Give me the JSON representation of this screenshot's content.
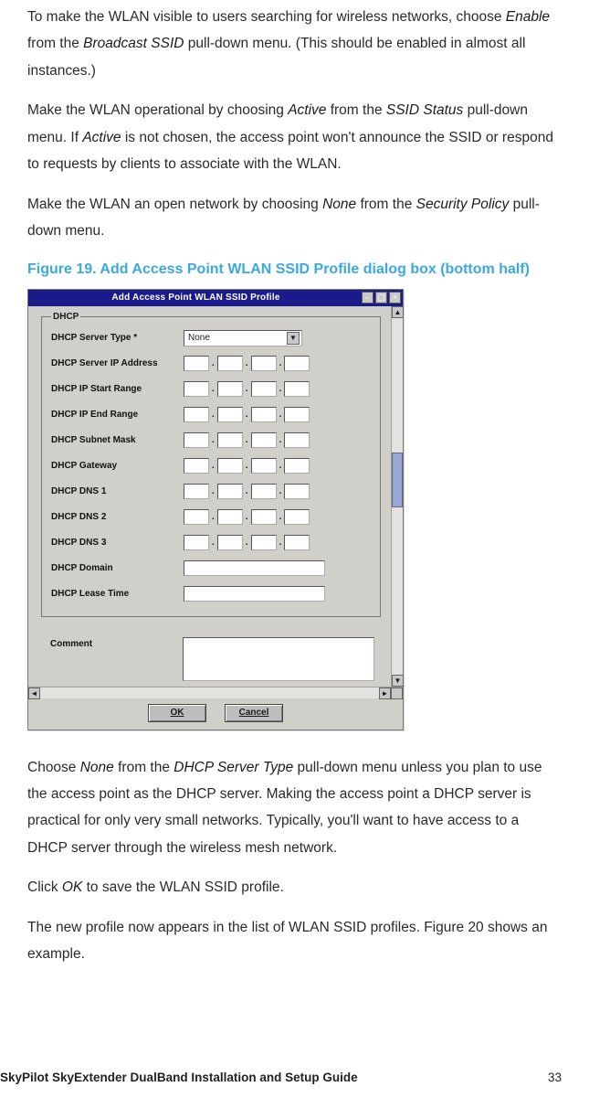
{
  "paragraphs": {
    "p1a": "To make the WLAN visible to users searching for wireless networks, choose ",
    "p1_enable": "Enable",
    "p1b": " from the ",
    "p1_broadcast": "Broadcast SSID",
    "p1c": " pull-down menu. (This should be enabled in almost all instances.)",
    "p2a": "Make the WLAN operational by choosing ",
    "p2_active1": "Active",
    "p2b": " from the ",
    "p2_ssidstatus": "SSID Status",
    "p2c": " pull-down menu. If ",
    "p2_active2": "Active",
    "p2d": " is not chosen, the access point won't announce the SSID or respond to requests by clients to associate with the WLAN.",
    "p3a": "Make the WLAN an open network by choosing ",
    "p3_none": "None",
    "p3b": " from the ",
    "p3_secpol": "Security Policy",
    "p3c": " pull-down menu.",
    "caption": "Figure 19. Add Access Point WLAN SSID Profile dialog box (bottom half)",
    "p4a": "Choose ",
    "p4_none": "None",
    "p4b": " from the ",
    "p4_dhcp": "DHCP Server Type",
    "p4c": " pull-down menu unless you plan to use the access point as the DHCP server. Making the access point a DHCP server is practical for only very small networks. Typically, you'll want to have access to a DHCP server through the wireless mesh network.",
    "p5a": "Click ",
    "p5_ok": "OK",
    "p5b": " to save the WLAN SSID profile.",
    "p6": "The new profile now appears in the list of WLAN SSID profiles. Figure 20 shows an example."
  },
  "dialog": {
    "title": "Add Access Point WLAN SSID Profile",
    "group": "DHCP",
    "fields": {
      "serverType": "DHCP Server Type *",
      "serverTypeValue": "None",
      "serverIp": "DHCP Server IP Address",
      "startRange": "DHCP IP Start Range",
      "endRange": "DHCP IP End Range",
      "subnet": "DHCP Subnet Mask",
      "gateway": "DHCP Gateway",
      "dns1": "DHCP DNS 1",
      "dns2": "DHCP DNS 2",
      "dns3": "DHCP DNS 3",
      "domain": "DHCP Domain",
      "lease": "DHCP Lease Time"
    },
    "comment": "Comment",
    "ok": "OK",
    "cancel": "Cancel"
  },
  "footer": {
    "title": "SkyPilot SkyExtender DualBand Installation and Setup Guide",
    "page": "33"
  }
}
